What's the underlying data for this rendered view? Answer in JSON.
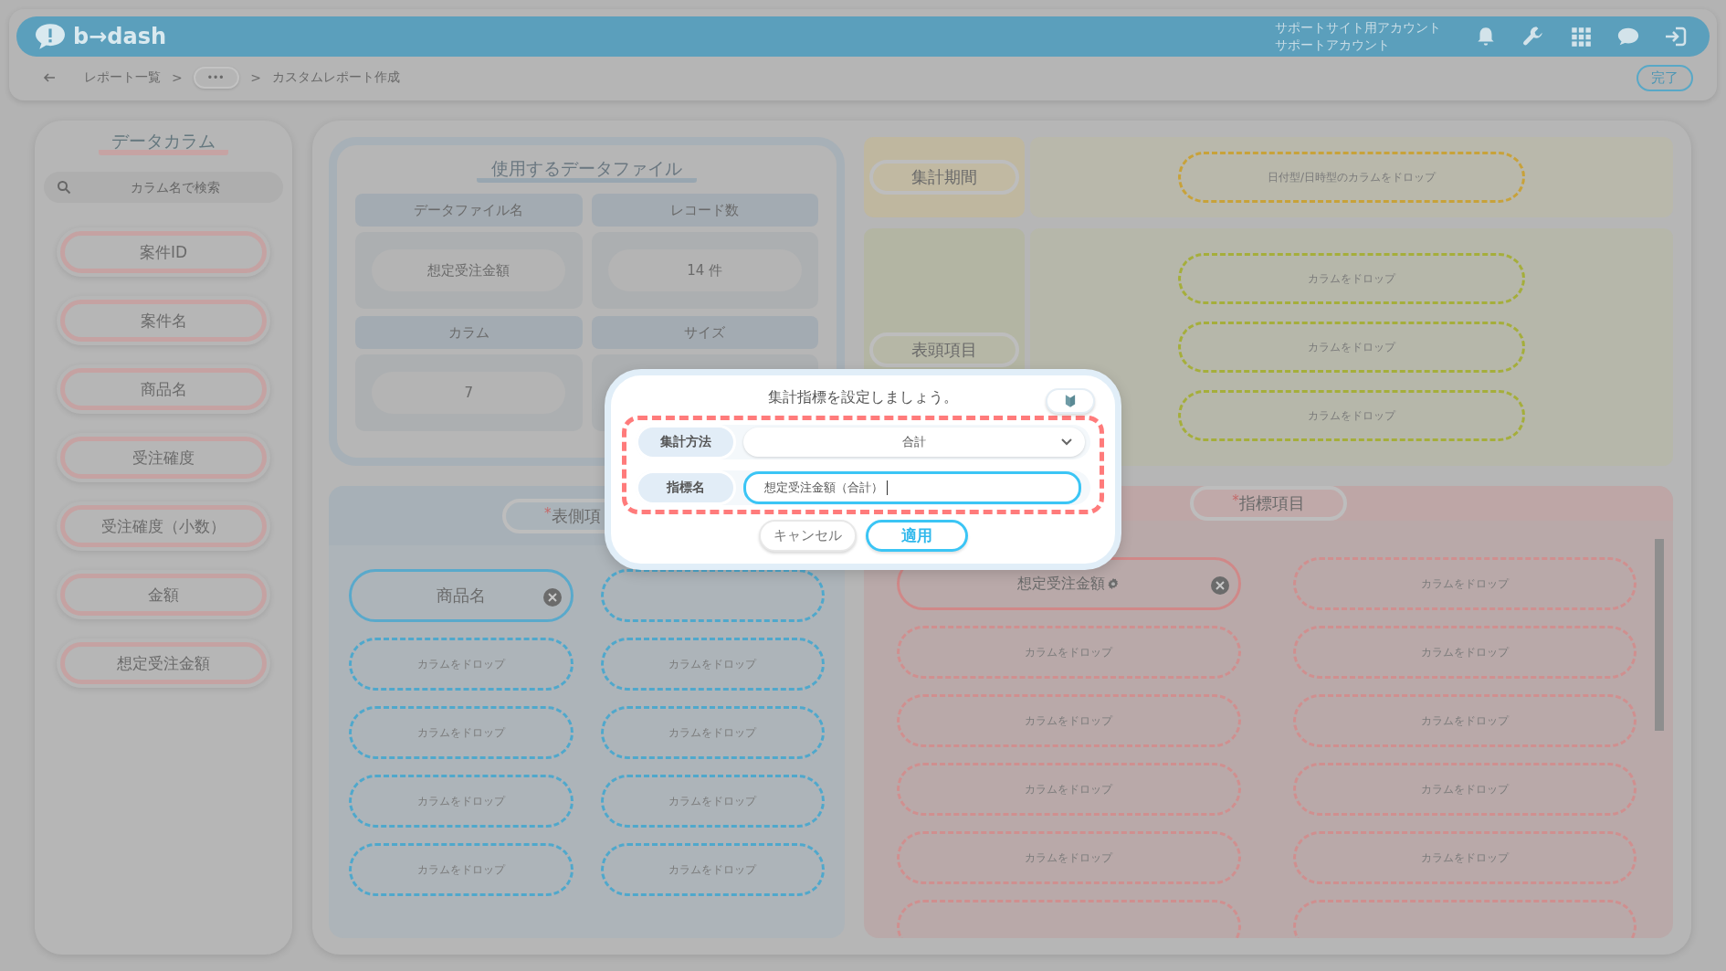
{
  "header": {
    "logo": "b→dash",
    "account_lines": [
      "サポートサイト用アカウント",
      "サポートアカウント"
    ]
  },
  "breadcrumb": {
    "items": [
      {
        "kind": "link",
        "text": "レポート一覧"
      },
      {
        "kind": "sep",
        "text": ">"
      },
      {
        "kind": "more",
        "text": "•••"
      },
      {
        "kind": "sep",
        "text": ">"
      },
      {
        "kind": "current",
        "text": "カスタムレポート作成"
      }
    ],
    "done": "完了"
  },
  "sidebar": {
    "title": "データカラム",
    "search_placeholder": "カラム名で検索",
    "columns": [
      "案件ID",
      "案件名",
      "商品名",
      "受注確度",
      "受注確度（小数）",
      "金額",
      "想定受注金額"
    ]
  },
  "data_file": {
    "title": "使用するデータファイル",
    "cells": [
      {
        "heading": "データファイル名",
        "value": "想定受注金額"
      },
      {
        "heading": "レコード数",
        "value": "14 件"
      },
      {
        "heading": "カラム",
        "value": "7"
      },
      {
        "heading": "サイズ"
      }
    ]
  },
  "period": {
    "label": "集計期間",
    "drop": "日付型/日時型のカラムをドロップ"
  },
  "header_items": {
    "label": "表頭項目",
    "slots": [
      "カラムをドロップ",
      "カラムをドロップ",
      "カラムをドロップ"
    ]
  },
  "row_items": {
    "required_mark": "*",
    "label": "表側項",
    "columns": [
      [
        {
          "kind": "filled",
          "text": "商品名"
        },
        {
          "kind": "drop",
          "text": "カラムをドロップ"
        },
        {
          "kind": "drop",
          "text": "カラムをドロップ"
        },
        {
          "kind": "drop",
          "text": "カラムをドロップ"
        },
        {
          "kind": "drop",
          "text": "カラムをドロップ"
        }
      ],
      [
        {
          "kind": "hidden"
        },
        {
          "kind": "drop",
          "text": "カラムをドロップ"
        },
        {
          "kind": "drop",
          "text": "カラムをドロップ"
        },
        {
          "kind": "drop",
          "text": "カラムをドロップ"
        },
        {
          "kind": "drop",
          "text": "カラムをドロップ"
        }
      ]
    ]
  },
  "metric_items": {
    "required_mark": "*",
    "label": "指標項目",
    "columns": [
      [
        {
          "kind": "filled",
          "text": "想定受注金額",
          "settings": true
        },
        {
          "kind": "drop",
          "text": "カラムをドロップ"
        },
        {
          "kind": "drop",
          "text": "カラムをドロップ"
        },
        {
          "kind": "drop",
          "text": "カラムをドロップ"
        },
        {
          "kind": "drop",
          "text": "カラムをドロップ"
        },
        {
          "kind": "cut"
        }
      ],
      [
        {
          "kind": "drop",
          "text": "カラムをドロップ"
        },
        {
          "kind": "drop",
          "text": "カラムをドロップ"
        },
        {
          "kind": "drop",
          "text": "カラムをドロップ"
        },
        {
          "kind": "drop",
          "text": "カラムをドロップ"
        },
        {
          "kind": "drop",
          "text": "カラムをドロップ"
        },
        {
          "kind": "cut"
        }
      ]
    ]
  },
  "modal": {
    "title": "集計指標を設定しましょう。",
    "method_label": "集計方法",
    "method_value": "合計",
    "name_label": "指標名",
    "name_value": "想定受注金額（合計）",
    "cancel": "キャンセル",
    "apply": "適用"
  }
}
